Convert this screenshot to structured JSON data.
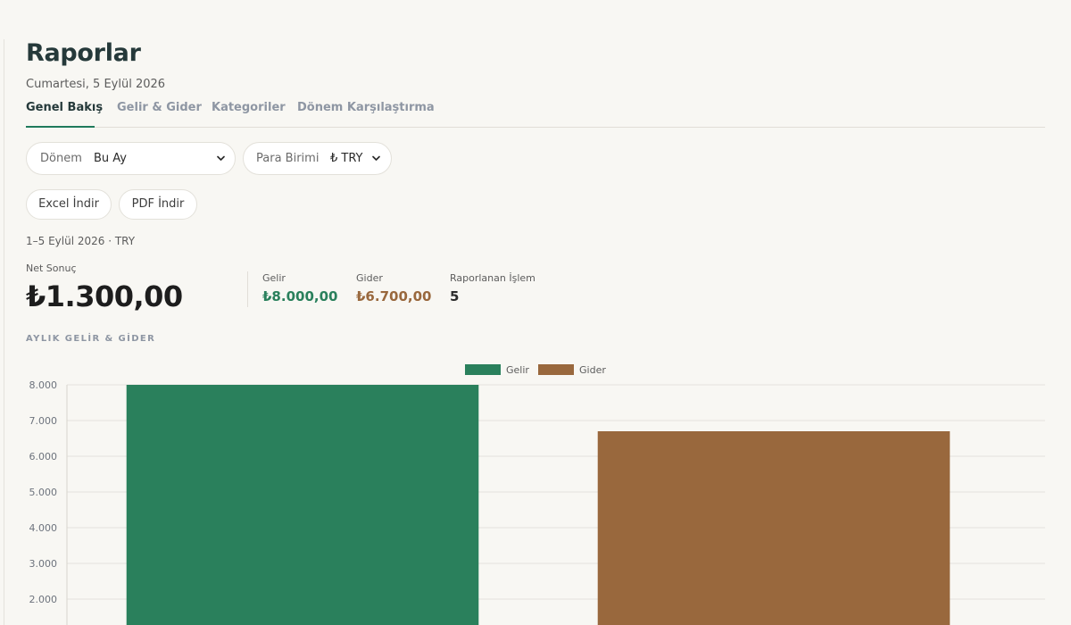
{
  "header": {
    "title": "Raporlar",
    "date": "Cumartesi, 5 Eylül 2026"
  },
  "tabs": [
    {
      "label": "Genel Bakış",
      "active": true
    },
    {
      "label": "Gelir & Gider",
      "active": false
    },
    {
      "label": "Kategoriler",
      "active": false
    },
    {
      "label": "Dönem Karşılaştırma",
      "active": false
    }
  ],
  "filters": {
    "period": {
      "label": "Dönem",
      "value": "Bu Ay"
    },
    "currency": {
      "label": "Para Birimi",
      "value": "₺ TRY"
    }
  },
  "actions": {
    "excel": "Excel İndir",
    "pdf": "PDF İndir"
  },
  "range_text": "1–5 Eylül 2026 · TRY",
  "summary": {
    "net_label": "Net Sonuç",
    "net_value": "₺1.300,00",
    "income_label": "Gelir",
    "income_value": "₺8.000,00",
    "expense_label": "Gider",
    "expense_value": "₺6.700,00",
    "count_label": "Raporlanan İşlem",
    "count_value": "5"
  },
  "colors": {
    "income": "#2a805c",
    "expense": "#99683d",
    "accent": "#1f7a5c"
  },
  "icons": {
    "dropdown": "chevron-down-icon"
  },
  "chart_data": {
    "type": "bar",
    "title": "AYLIK GELİR & GİDER",
    "legend_position": "top-center",
    "grid": true,
    "categories": [
      ""
    ],
    "series": [
      {
        "name": "Gelir",
        "values": [
          8000
        ],
        "color": "#2a805c"
      },
      {
        "name": "Gider",
        "values": [
          6700
        ],
        "color": "#99683d"
      }
    ],
    "yticks": [
      "2.000",
      "3.000",
      "4.000",
      "5.000",
      "6.000",
      "7.000",
      "8.000"
    ],
    "ylim": [
      0,
      8000
    ]
  }
}
